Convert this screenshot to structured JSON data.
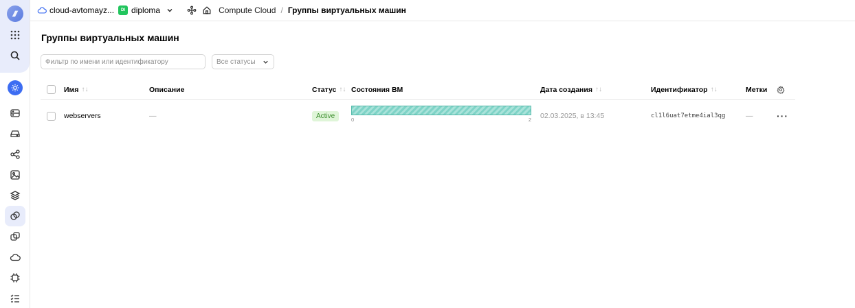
{
  "header": {
    "cloud_name": "cloud-avtomayz...",
    "folder_badge": "DI",
    "folder_name": "diploma",
    "breadcrumb_service": "Compute Cloud",
    "breadcrumb_separator": "/",
    "breadcrumb_current": "Группы виртуальных машин"
  },
  "main": {
    "title": "Группы виртуальных машин",
    "filter_placeholder": "Фильтр по имени или идентификатору",
    "status_select_value": "Все статусы"
  },
  "table": {
    "columns": {
      "name": "Имя",
      "description": "Описание",
      "status": "Статус",
      "vm_states": "Состояния ВМ",
      "created": "Дата создания",
      "id": "Идентификатор",
      "labels": "Метки"
    },
    "sort_glyph": "↑↓",
    "rows": [
      {
        "name": "webservers",
        "description": "—",
        "status": "Active",
        "vm_running": 2,
        "vm_total": 2,
        "vm_min_label": "0",
        "vm_max_label": "2",
        "created": "02.03.2025, в 13:45",
        "id": "cl1l6uat7etme4ial3qg",
        "labels": "—",
        "actions": "···"
      }
    ]
  },
  "colors": {
    "accent": "#3d6df2",
    "active_badge_bg": "#dff5d8",
    "active_badge_text": "#3b8d2c",
    "vm_bar": "#7fd3c7",
    "folder_badge": "#22c55e"
  },
  "icons": {
    "sidebar": [
      "logo-icon",
      "apps-grid-icon",
      "search-icon",
      "compute-cloud-icon",
      "server-icon",
      "disk-icon",
      "share-icon",
      "image-icon",
      "layers-icon",
      "instance-groups-icon",
      "copy-icon",
      "cloud-icon",
      "chip-icon",
      "checklist-icon"
    ]
  }
}
